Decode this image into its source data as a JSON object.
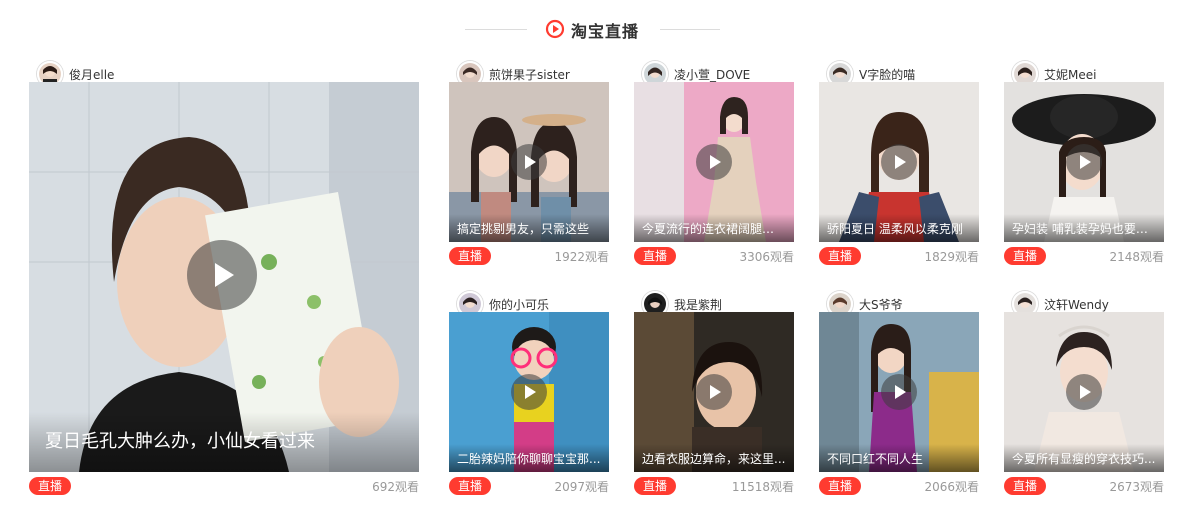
{
  "section": {
    "title": "淘宝直播",
    "accent": "#ff3b30"
  },
  "featured": {
    "host": "俊月elle",
    "caption": "夏日毛孔大肿么办，小仙女看过来",
    "badge": "直播",
    "views": "692观看"
  },
  "streams": [
    {
      "host": "煎饼果子sister",
      "caption": "搞定挑剔男友，只需这些",
      "badge": "直播",
      "views": "1922观看"
    },
    {
      "host": "凌小萱_DOVE",
      "caption": "今夏流行的连衣裙阔腿裤 ...",
      "badge": "直播",
      "views": "3306观看"
    },
    {
      "host": "V字脸的喵",
      "caption": "骄阳夏日 温柔风以柔克刚",
      "badge": "直播",
      "views": "1829观看"
    },
    {
      "host": "艾妮Meei",
      "caption": "孕妇装 哺乳装孕妈也要美...",
      "badge": "直播",
      "views": "2148观看"
    },
    {
      "host": "你的小可乐",
      "caption": "二胎辣妈陪你聊聊宝宝那...",
      "badge": "直播",
      "views": "2097观看"
    },
    {
      "host": "我是紫荆",
      "caption": "边看衣服边算命，来这里...",
      "badge": "直播",
      "views": "11518观看"
    },
    {
      "host": "大S爷爷",
      "caption": "不同口红不同人生",
      "badge": "直播",
      "views": "2066观看"
    },
    {
      "host": "汶轩Wendy",
      "caption": "今夏所有显瘦的穿衣技巧...",
      "badge": "直播",
      "views": "2673观看"
    }
  ]
}
